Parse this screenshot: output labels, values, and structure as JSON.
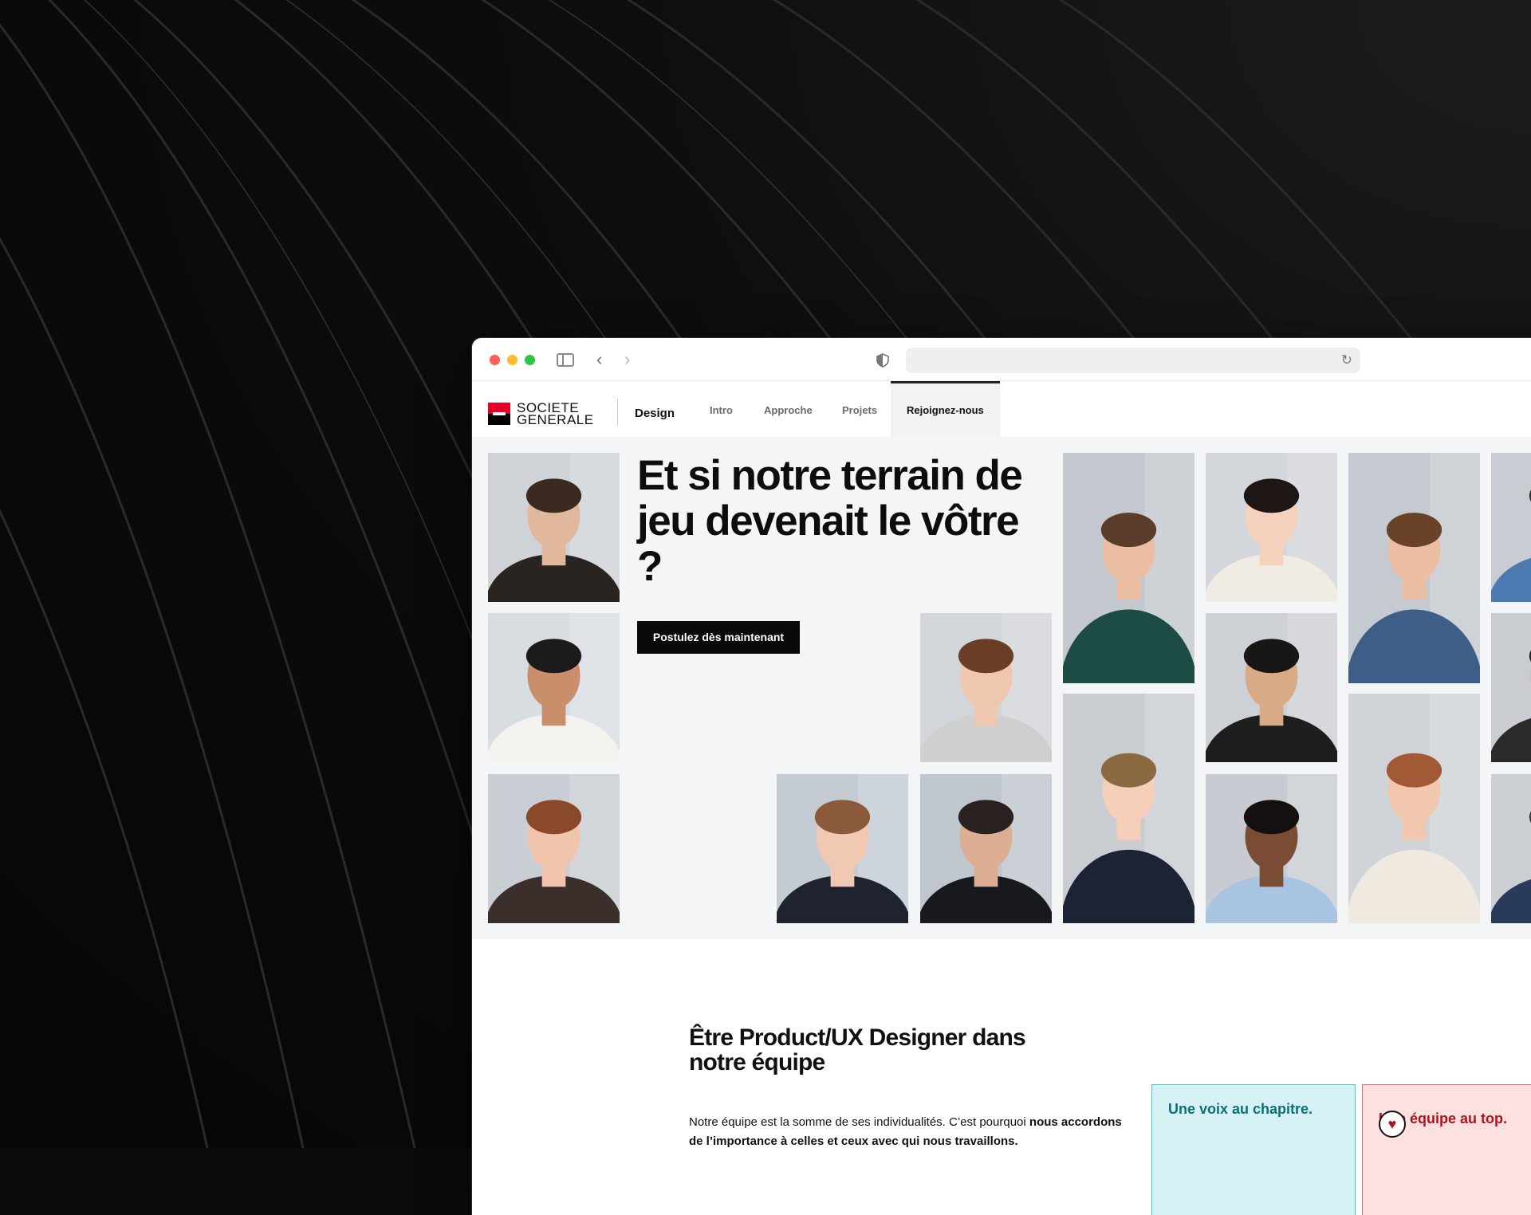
{
  "browser": {
    "traffic_lights": [
      "close",
      "minimize",
      "zoom"
    ],
    "icons": [
      "sidebar-icon",
      "back-icon",
      "forward-icon",
      "shield-icon",
      "reload-icon"
    ],
    "url": ""
  },
  "nav": {
    "logo_line1": "SOCIETE",
    "logo_line2": "GENERALE",
    "brand": "Design",
    "items": [
      "Intro",
      "Approche",
      "Projets",
      "Rejoignez-nous"
    ],
    "active": "Rejoignez-nous"
  },
  "hero": {
    "headline": "Et si notre terrain de jeu devenait le vôtre ?",
    "cta": "Postulez dès maintenant",
    "photos_count": 18
  },
  "section": {
    "title": "Être Product/UX Designer dans notre équipe",
    "body_plain": "Notre équipe est la somme de ses individualités. C’est pourquoi ",
    "body_bold": "nous accordons de l’importance à celles et ceux avec qui nous travaillons.",
    "card_blue": "Une voix au chapitre.",
    "card_pink": "Une équipe au top."
  },
  "colors": {
    "brand_red": "#e60028",
    "hero_bg": "#f4f5f7",
    "card_blue_bg": "#d6f2f4",
    "card_blue_text": "#0b6f7a",
    "card_pink_bg": "#fde0e0",
    "card_pink_text": "#b0141b"
  }
}
